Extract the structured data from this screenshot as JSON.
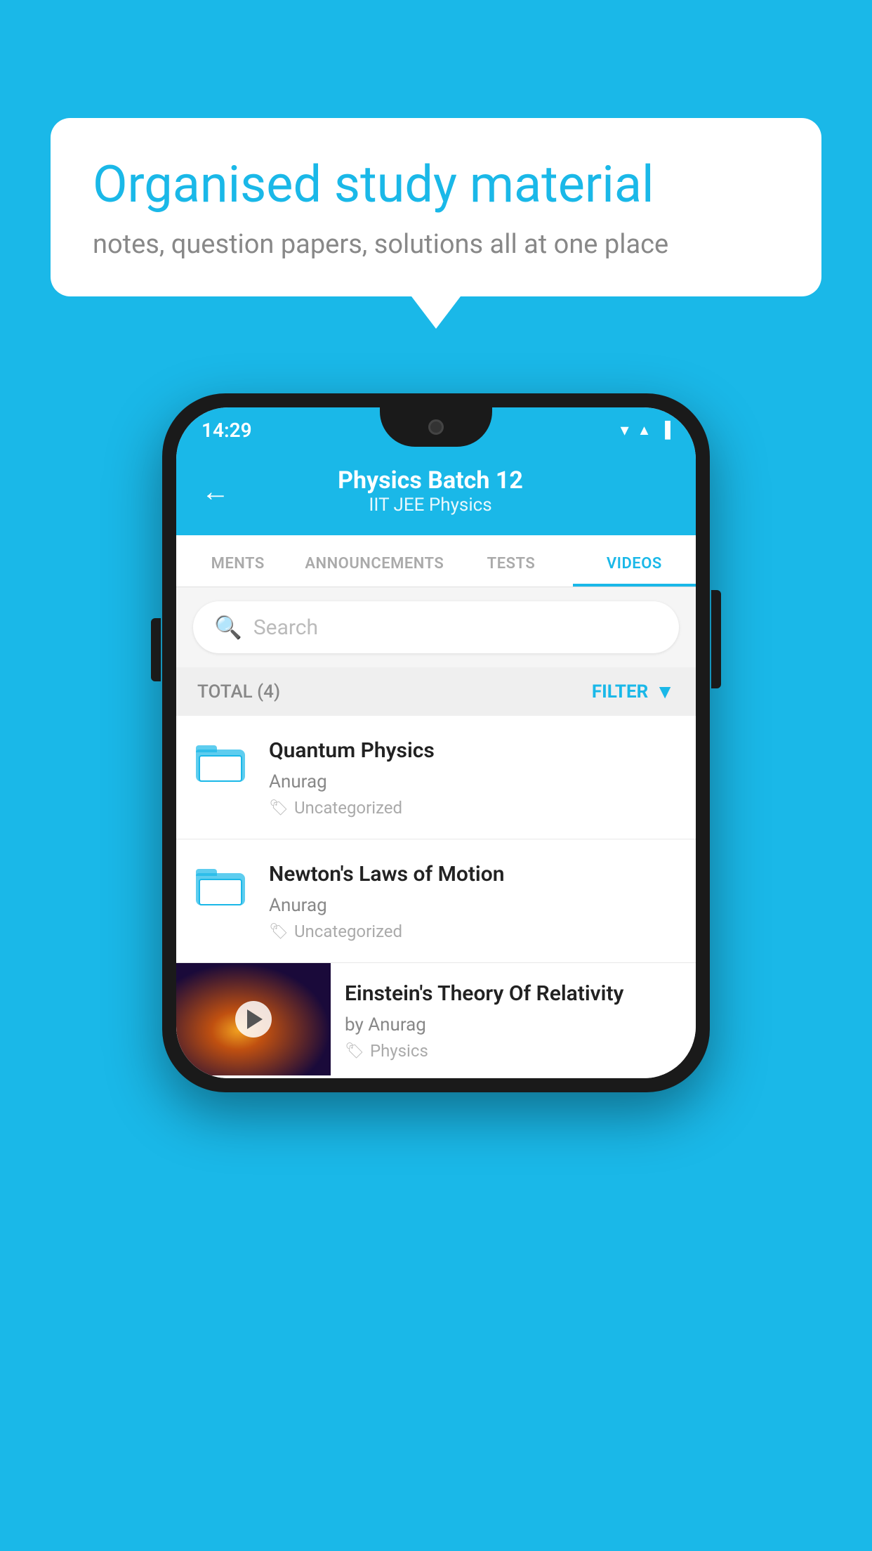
{
  "background": {
    "color": "#1ab8e8"
  },
  "bubble": {
    "title": "Organised study material",
    "subtitle": "notes, question papers, solutions all at one place"
  },
  "phone": {
    "status_bar": {
      "time": "14:29",
      "icons": [
        "wifi",
        "signal",
        "battery"
      ]
    },
    "header": {
      "back_label": "←",
      "title": "Physics Batch 12",
      "subtitle": "IIT JEE   Physics"
    },
    "tabs": [
      {
        "label": "MENTS",
        "active": false
      },
      {
        "label": "ANNOUNCEMENTS",
        "active": false
      },
      {
        "label": "TESTS",
        "active": false
      },
      {
        "label": "VIDEOS",
        "active": true
      }
    ],
    "search": {
      "placeholder": "Search"
    },
    "filter_bar": {
      "total_label": "TOTAL (4)",
      "filter_label": "FILTER"
    },
    "videos": [
      {
        "title": "Quantum Physics",
        "author": "Anurag",
        "tag": "Uncategorized",
        "has_thumbnail": false
      },
      {
        "title": "Newton's Laws of Motion",
        "author": "Anurag",
        "tag": "Uncategorized",
        "has_thumbnail": false
      },
      {
        "title": "Einstein's Theory Of Relativity",
        "author": "by Anurag",
        "tag": "Physics",
        "has_thumbnail": true
      }
    ]
  }
}
